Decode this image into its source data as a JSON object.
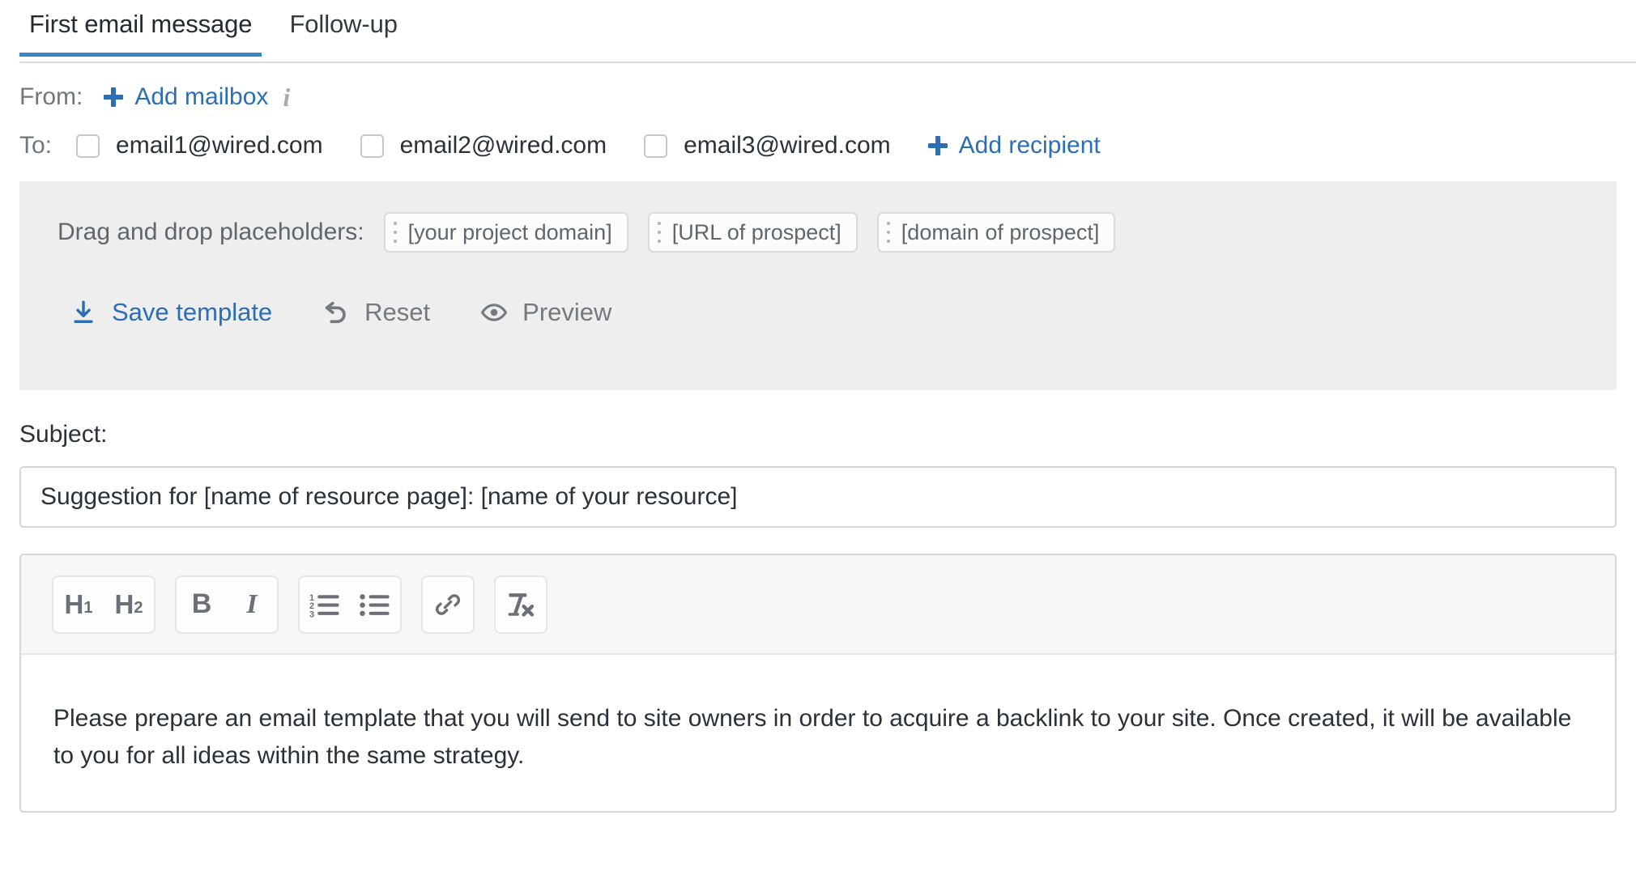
{
  "tabs": [
    {
      "label": "First email message",
      "active": true
    },
    {
      "label": "Follow-up",
      "active": false
    }
  ],
  "from": {
    "label": "From:",
    "add_mailbox_label": "Add mailbox",
    "info_icon": "info-icon",
    "plus_icon": "plus-icon"
  },
  "to": {
    "label": "To:",
    "recipients": [
      {
        "email": "email1@wired.com",
        "checked": false
      },
      {
        "email": "email2@wired.com",
        "checked": false
      },
      {
        "email": "email3@wired.com",
        "checked": false
      }
    ],
    "add_recipient_label": "Add recipient"
  },
  "placeholders": {
    "label": "Drag and drop placeholders:",
    "chips": [
      {
        "label": "[your project domain]",
        "grip_icon": "drag-handle-icon"
      },
      {
        "label": "[URL of prospect]",
        "grip_icon": "drag-handle-icon"
      },
      {
        "label": "[domain of prospect]",
        "grip_icon": "drag-handle-icon"
      }
    ]
  },
  "actions": [
    {
      "label": "Save template",
      "icon": "download-icon",
      "style": "primary"
    },
    {
      "label": "Reset",
      "icon": "undo-icon",
      "style": "muted"
    },
    {
      "label": "Preview",
      "icon": "eye-icon",
      "style": "muted"
    }
  ],
  "subject": {
    "label": "Subject:",
    "value": "Suggestion for [name of resource page]: [name of your resource]",
    "placeholder": "Subject"
  },
  "editor": {
    "toolbar": [
      {
        "name": "heading-1",
        "label": "H",
        "sub": "1",
        "icon": "h1-icon"
      },
      {
        "name": "heading-2",
        "label": "H",
        "sub": "2",
        "icon": "h2-icon"
      },
      {
        "name": "bold",
        "label": "B",
        "icon": "bold-icon"
      },
      {
        "name": "italic",
        "label": "I",
        "icon": "italic-icon"
      },
      {
        "name": "ordered-list",
        "label": "",
        "icon": "ordered-list-icon"
      },
      {
        "name": "bullet-list",
        "label": "",
        "icon": "bullet-list-icon"
      },
      {
        "name": "link",
        "label": "",
        "icon": "link-icon"
      },
      {
        "name": "clear-formatting",
        "label": "",
        "icon": "clear-formatting-icon"
      }
    ],
    "body": "Please prepare an email template that you will send to site owners in order to acquire a backlink to your site. Once created, it will be available to you for all ideas within the same strategy."
  },
  "colors": {
    "accent_blue": "#2c6eb5",
    "tab_underline": "#3a87c8",
    "panel_gray": "#eeeeee",
    "text_dark": "#2b3138",
    "text_muted": "#6f7680",
    "border": "#d3d6d9"
  }
}
